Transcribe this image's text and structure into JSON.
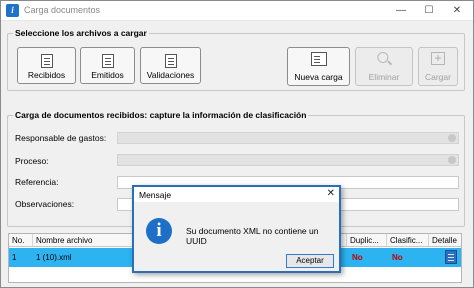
{
  "window": {
    "title": "Carga documentos",
    "minimize_glyph": "—",
    "maximize_glyph": "☐",
    "close_glyph": "✕",
    "app_icon_letter": "i"
  },
  "select_group": {
    "title": "Seleccione los archivos a cargar",
    "buttons": {
      "recibidos": "Recibidos",
      "emitidos": "Emitidos",
      "validaciones": "Validaciones",
      "nueva_carga": "Nueva carga",
      "eliminar": "Eliminar",
      "cargar": "Cargar"
    },
    "cargar_glyph": "+"
  },
  "capture_group": {
    "title": "Carga de documentos recibidos: capture la información de clasificación",
    "fields": {
      "responsable": "Responsable de gastos:",
      "proceso": "Proceso:",
      "referencia": "Referencia:",
      "observaciones": "Observaciones:"
    }
  },
  "grid": {
    "columns": {
      "no": "No.",
      "nombre_archivo": "Nombre archivo",
      "duplicado": "Duplic...",
      "clasificado": "Clasific...",
      "detalle": "Detalle"
    },
    "rows": [
      {
        "no": "1",
        "nombre_archivo": "1 (10).xml",
        "duplicado": "No",
        "clasificado": "No"
      }
    ]
  },
  "dialog": {
    "title": "Mensaje",
    "close_glyph": "✕",
    "icon_letter": "i",
    "message": "Su documento XML no contiene un UUID",
    "ok_label": "Aceptar"
  },
  "colors": {
    "selected_row": "#2db4f0",
    "accent_blue": "#2a6fba",
    "no_value_red": "#c00000"
  }
}
